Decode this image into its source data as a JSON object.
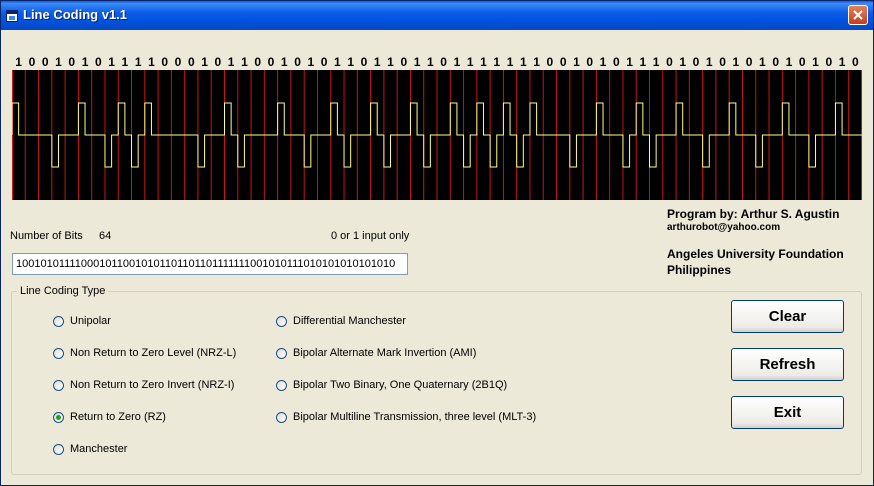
{
  "window": {
    "title": "Line Coding v1.1",
    "icons": {
      "app": "app-icon",
      "close": "close-icon"
    }
  },
  "bits_display": "1001010111100010110010101101101101111111001010111010101010101010",
  "info": {
    "number_of_bits_label": "Number of Bits",
    "number_of_bits_value": "64",
    "input_hint": "0 or 1 input only"
  },
  "bits_input": {
    "value": "1001010111100010110010101101101101111111001010111010101010101010"
  },
  "credits": {
    "program_by": "Program by: Arthur S. Agustin",
    "email": "arthurobot@yahoo.com",
    "org_line1": "Angeles University Foundation",
    "org_line2": "Philippines"
  },
  "line_coding": {
    "group_label": "Line Coding Type",
    "selected": "Return to Zero (RZ)",
    "options_left": [
      "Unipolar",
      "Non Return to Zero Level (NRZ-L)",
      "Non Return to Zero Invert (NRZ-I)",
      "Return to Zero (RZ)",
      "Manchester"
    ],
    "options_right": [
      "Differential Manchester",
      "Bipolar Alternate Mark Invertion (AMI)",
      "Bipolar Two Binary, One Quaternary (2B1Q)",
      "Bipolar Multiline Transmission, three level (MLT-3)"
    ]
  },
  "buttons": {
    "clear": "Clear",
    "refresh": "Refresh",
    "exit": "Exit"
  },
  "colors": {
    "plot_background": "#000000",
    "grid_line": "#c81414",
    "signal": "#ffff80",
    "title_bar": "#0055e3",
    "radio_selected": "#21a121"
  }
}
